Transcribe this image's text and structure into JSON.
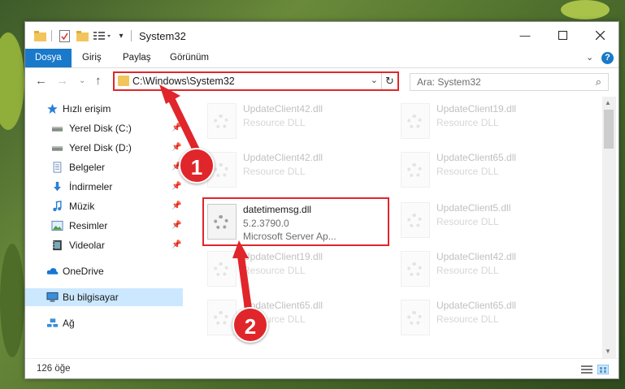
{
  "window": {
    "title": "System32"
  },
  "ribbon": {
    "tabs": [
      {
        "label": "Dosya",
        "active": true
      },
      {
        "label": "Giriş",
        "active": false
      },
      {
        "label": "Paylaş",
        "active": false
      },
      {
        "label": "Görünüm",
        "active": false
      }
    ]
  },
  "navigation": {
    "address": "C:\\Windows\\System32",
    "search_placeholder": "Ara: System32"
  },
  "sidebar": {
    "items": [
      {
        "label": "Hızlı erişim",
        "icon": "star-icon",
        "pinned": false,
        "selected": false
      },
      {
        "label": "Yerel Disk (C:)",
        "icon": "drive-icon",
        "pinned": true,
        "selected": false
      },
      {
        "label": "Yerel Disk (D:)",
        "icon": "drive-icon",
        "pinned": true,
        "selected": false
      },
      {
        "label": "Belgeler",
        "icon": "documents-icon",
        "pinned": true,
        "selected": false
      },
      {
        "label": "İndirmeler",
        "icon": "download-icon",
        "pinned": true,
        "selected": false
      },
      {
        "label": "Müzik",
        "icon": "music-icon",
        "pinned": true,
        "selected": false
      },
      {
        "label": "Resimler",
        "icon": "pictures-icon",
        "pinned": true,
        "selected": false
      },
      {
        "label": "Videolar",
        "icon": "videos-icon",
        "pinned": true,
        "selected": false
      },
      {
        "label": "OneDrive",
        "icon": "cloud-icon",
        "pinned": false,
        "selected": false
      },
      {
        "label": "Bu bilgisayar",
        "icon": "computer-icon",
        "pinned": false,
        "selected": true
      },
      {
        "label": "Ağ",
        "icon": "network-icon",
        "pinned": false,
        "selected": false
      }
    ]
  },
  "files": {
    "col1": [
      {
        "name": "UpdateClient42.dll",
        "type": "Resource DLL"
      },
      {
        "name": "UpdateClient42.dll",
        "type": "Resource DLL"
      },
      {
        "name": "datetimemsg.dll",
        "version": "5.2.3790.0",
        "description": "Microsoft Server Ap..."
      },
      {
        "name": "UpdateClient19.dll",
        "type": "Resource DLL"
      },
      {
        "name": "UpdateClient65.dll",
        "type": "Resource DLL"
      }
    ],
    "col2": [
      {
        "name": "UpdateClient19.dll",
        "type": "Resource DLL"
      },
      {
        "name": "UpdateClient65.dll",
        "type": "Resource DLL"
      },
      {
        "name": "UpdateClient5.dll",
        "type": "Resource DLL"
      },
      {
        "name": "UpdateClient42.dll",
        "type": "Resource DLL"
      },
      {
        "name": "UpdateClient65.dll",
        "type": "Resource DLL"
      }
    ]
  },
  "status": {
    "item_count": "126 öğe"
  },
  "callouts": {
    "one": "1",
    "two": "2"
  },
  "colors": {
    "accent": "#1979ca",
    "highlight": "#e0262a",
    "selection": "#cce8ff"
  }
}
